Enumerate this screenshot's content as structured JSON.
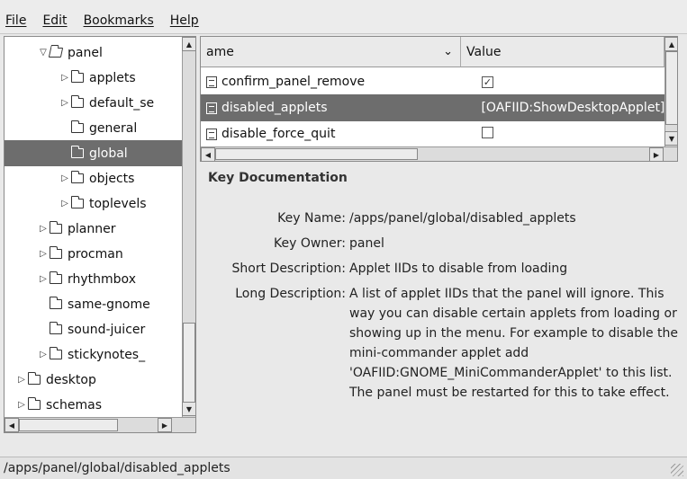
{
  "menu": [
    "File",
    "Edit",
    "Bookmarks",
    "Help"
  ],
  "tree": [
    {
      "label": "panel",
      "expander": "▽",
      "indent": 2,
      "open": true
    },
    {
      "label": "applets",
      "expander": "▷",
      "indent": 3
    },
    {
      "label": "default_se",
      "expander": "▷",
      "indent": 3
    },
    {
      "label": "general",
      "expander": "",
      "indent": 3
    },
    {
      "label": "global",
      "expander": "",
      "indent": 3,
      "selected": true
    },
    {
      "label": "objects",
      "expander": "▷",
      "indent": 3
    },
    {
      "label": "toplevels",
      "expander": "▷",
      "indent": 3
    },
    {
      "label": "planner",
      "expander": "▷",
      "indent": 2
    },
    {
      "label": "procman",
      "expander": "▷",
      "indent": 2
    },
    {
      "label": "rhythmbox",
      "expander": "▷",
      "indent": 2
    },
    {
      "label": "same-gnome",
      "expander": "",
      "indent": 2
    },
    {
      "label": "sound-juicer",
      "expander": "",
      "indent": 2
    },
    {
      "label": "stickynotes_",
      "expander": "▷",
      "indent": 2
    },
    {
      "label": "desktop",
      "expander": "▷",
      "indent": 1
    },
    {
      "label": "schemas",
      "expander": "▷",
      "indent": 1
    }
  ],
  "list": {
    "col_name": "ame",
    "col_value": "Value",
    "rows": [
      {
        "name": "confirm_panel_remove",
        "value": "",
        "checked": true
      },
      {
        "name": "disabled_applets",
        "value": "[OAFIID:ShowDesktopApplet]",
        "selected": true
      },
      {
        "name": "disable_force_quit",
        "value": "",
        "checked": false
      }
    ]
  },
  "doc": {
    "title": "Key Documentation",
    "key_name_label": "Key Name:",
    "key_name": "/apps/panel/global/disabled_applets",
    "key_owner_label": "Key Owner:",
    "key_owner": "panel",
    "short_desc_label": "Short Description:",
    "short_desc": "Applet IIDs to disable from loading",
    "long_desc_label": "Long Description:",
    "long_desc": "A list of applet IIDs that the panel will ignore. This way you can disable certain applets from loading or showing up in the menu. For example to disable the mini-commander applet add 'OAFIID:GNOME_MiniCommanderApplet' to this list. The panel must be restarted for this to take effect."
  },
  "status": "/apps/panel/global/disabled_applets",
  "colors": {
    "selection": "#6d6d6d",
    "background": "#e9e9e9"
  },
  "icons": {
    "check": "✓",
    "scroll_up": "▲",
    "scroll_down": "▼",
    "scroll_left": "◀",
    "scroll_right": "▶",
    "sort": "⌄"
  }
}
